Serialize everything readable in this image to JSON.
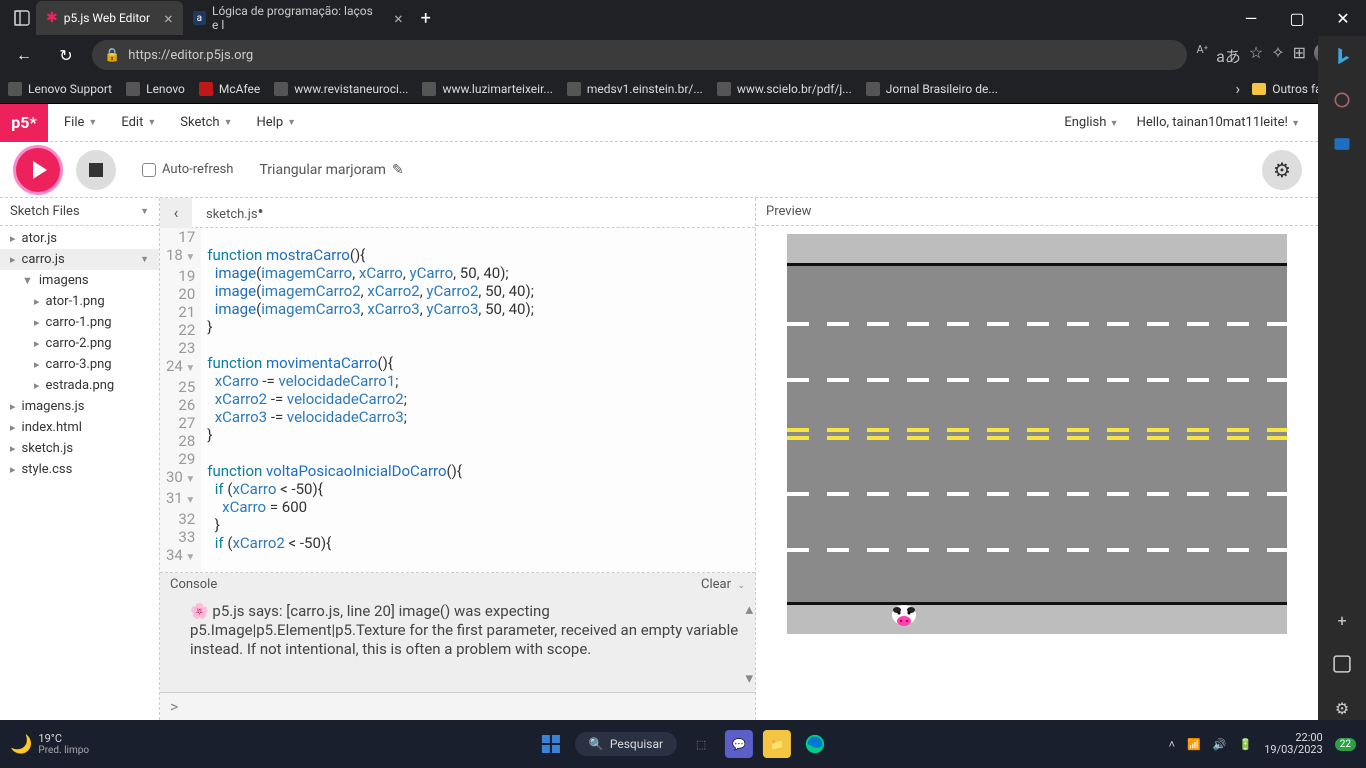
{
  "browser": {
    "tabs": [
      {
        "title": "p5.js Web Editor",
        "active": true
      },
      {
        "title": "Lógica de programação: laços e l",
        "active": false
      }
    ],
    "url": "https://editor.p5js.org",
    "bookmarks": [
      "Lenovo Support",
      "Lenovo",
      "McAfee",
      "www.revistaneuroci...",
      "www.luzimarteixeir...",
      "medsv1.einstein.br/...",
      "www.scielo.br/pdf/j...",
      "Jornal Brasileiro de..."
    ],
    "other_favs": "Outros favoritos"
  },
  "p5": {
    "logo": "p5*",
    "menus": [
      "File",
      "Edit",
      "Sketch",
      "Help"
    ],
    "lang": "English",
    "greeting": "Hello, tainan10mat11leite!",
    "auto_refresh": "Auto-refresh",
    "sketch_name": "Triangular marjoram",
    "sidebar_title": "Sketch Files",
    "files": {
      "ator": "ator.js",
      "carro": "carro.js",
      "imagens_folder": "imagens",
      "img1": "ator-1.png",
      "img2": "carro-1.png",
      "img3": "carro-2.png",
      "img4": "carro-3.png",
      "img5": "estrada.png",
      "imagens_js": "imagens.js",
      "index": "index.html",
      "sketch": "sketch.js",
      "style": "style.css"
    },
    "open_file": "sketch.js",
    "preview_label": "Preview",
    "console_label": "Console",
    "clear_label": "Clear",
    "console_msg_pre": "🌸 p5.js says: [carro.js, line 20] image() was expecting p5.Image|p5.Element|p5.Texture for the first parameter, received an empty variable instead. If not intentional, this is often a problem with scope.",
    "prompt": ">"
  },
  "code": {
    "lines": [
      {
        "n": 17,
        "t": ""
      },
      {
        "n": 18,
        "fold": true,
        "t_html": "<span class='kw'>function</span> <span class='fn'>mostraCarro</span>(){"
      },
      {
        "n": 19,
        "t_html": "  <span class='fn'>image</span>(<span class='id'>imagemCarro</span>, <span class='id'>xCarro</span>, <span class='id'>yCarro</span>, 50, 40);"
      },
      {
        "n": 20,
        "t_html": "  <span class='fn'>image</span>(<span class='id'>imagemCarro2</span>, <span class='id'>xCarro2</span>, <span class='id'>yCarro2</span>, 50, 40);"
      },
      {
        "n": 21,
        "t_html": "  <span class='fn'>image</span>(<span class='id'>imagemCarro3</span>, <span class='id'>xCarro3</span>, <span class='id'>yCarro3</span>, 50, 40);"
      },
      {
        "n": 22,
        "t_html": "}"
      },
      {
        "n": 23,
        "t_html": ""
      },
      {
        "n": 24,
        "fold": true,
        "t_html": "<span class='kw'>function</span> <span class='fn'>movimentaCarro</span>(){"
      },
      {
        "n": 25,
        "t_html": "  <span class='id'>xCarro</span> -= <span class='id'>velocidadeCarro1</span>;"
      },
      {
        "n": 26,
        "t_html": "  <span class='id'>xCarro2</span> -= <span class='id'>velocidadeCarro2</span>;"
      },
      {
        "n": 27,
        "t_html": "  <span class='id'>xCarro3</span> -= <span class='id'>velocidadeCarro3</span>;"
      },
      {
        "n": 28,
        "t_html": "}"
      },
      {
        "n": 29,
        "t_html": ""
      },
      {
        "n": 30,
        "fold": true,
        "t_html": "<span class='kw'>function</span> <span class='fn'>voltaPosicaoInicialDoCarro</span>(){"
      },
      {
        "n": 31,
        "fold": true,
        "t_html": "  <span class='kw'>if</span> (<span class='id'>xCarro</span> &lt; -50){"
      },
      {
        "n": 32,
        "t_html": "    <span class='id'>xCarro</span> = 600"
      },
      {
        "n": 33,
        "t_html": "  }"
      },
      {
        "n": 34,
        "fold": true,
        "t_html": "  <span class='kw'>if</span> (<span class='id'>xCarro2</span> &lt; -50){"
      }
    ]
  },
  "taskbar": {
    "temp": "19°C",
    "weather": "Pred. limpo",
    "search": "Pesquisar",
    "time": "22:00",
    "date": "19/03/2023",
    "badge": "22"
  }
}
